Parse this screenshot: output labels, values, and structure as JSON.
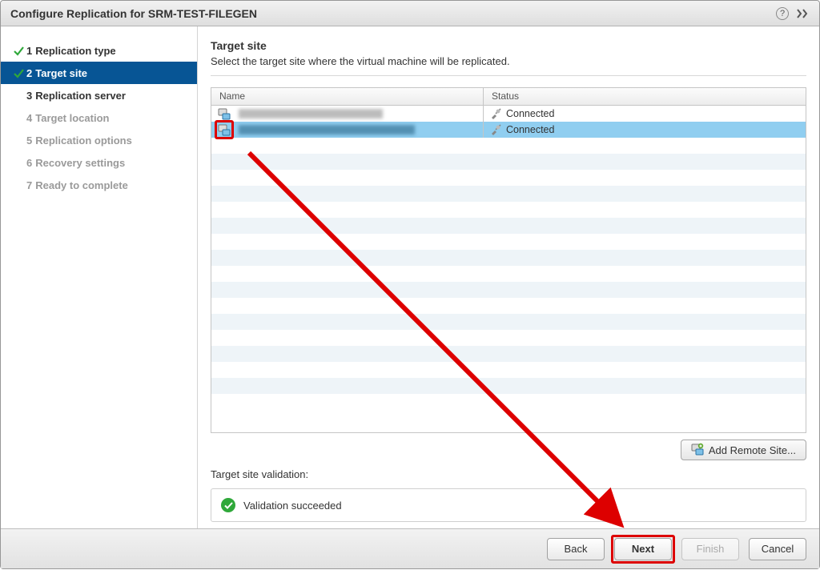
{
  "title": "Configure Replication for SRM-TEST-FILEGEN",
  "steps": [
    {
      "num": "1",
      "label": "Replication type",
      "state": "done"
    },
    {
      "num": "2",
      "label": "Target site",
      "state": "active"
    },
    {
      "num": "3",
      "label": "Replication server",
      "state": "next"
    },
    {
      "num": "4",
      "label": "Target location",
      "state": "future"
    },
    {
      "num": "5",
      "label": "Replication options",
      "state": "future"
    },
    {
      "num": "6",
      "label": "Recovery settings",
      "state": "future"
    },
    {
      "num": "7",
      "label": "Ready to complete",
      "state": "future"
    }
  ],
  "main": {
    "title": "Target site",
    "subtitle": "Select the target site where the virtual machine will be replicated."
  },
  "table": {
    "columns": {
      "name": "Name",
      "status": "Status"
    },
    "rows": [
      {
        "name_redacted": true,
        "status": "Connected",
        "selected": false
      },
      {
        "name_redacted": true,
        "status": "Connected",
        "selected": true
      }
    ]
  },
  "add_remote_label": "Add Remote Site...",
  "validation": {
    "title": "Target site validation:",
    "message": "Validation succeeded"
  },
  "buttons": {
    "back": "Back",
    "next": "Next",
    "finish": "Finish",
    "cancel": "Cancel"
  },
  "icons": {
    "help": "?",
    "site": "site-icon",
    "plug": "plug-icon",
    "add_remote": "add-remote-icon",
    "ok": "ok-icon"
  }
}
